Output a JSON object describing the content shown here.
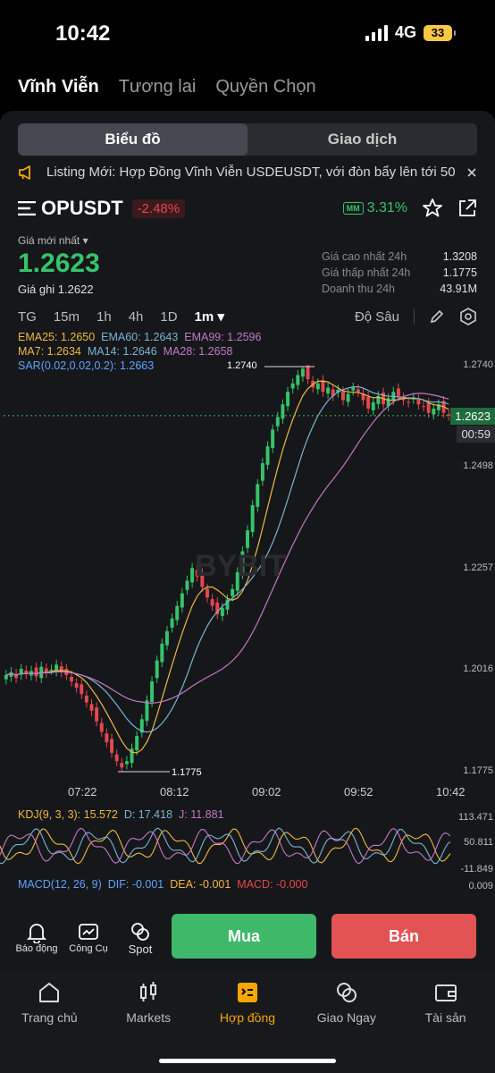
{
  "status": {
    "time": "10:42",
    "network": "4G",
    "battery": "33"
  },
  "top_tabs": [
    {
      "label": "Vĩnh Viễn",
      "active": true
    },
    {
      "label": "Tương lai"
    },
    {
      "label": "Quyền Chọn"
    }
  ],
  "segments": [
    {
      "label": "Biểu đồ",
      "active": true
    },
    {
      "label": "Giao dịch"
    }
  ],
  "announcement": {
    "text": "Listing Mới:  Hợp Đồng Vĩnh Viễn USDEUSDT, với đòn bẩy lên tới 50",
    "icon": "megaphone-icon"
  },
  "ticker": {
    "symbol": "OPUSDT",
    "change": "-2.48%",
    "mm_badge": "MM",
    "mm_ratio": "3.31%"
  },
  "price": {
    "last_label": "Giá mới nhất",
    "last": "1.2623",
    "mark": "Giá ghi 1.2622"
  },
  "stats": [
    {
      "label": "Giá cao nhất 24h",
      "value": "1.3208"
    },
    {
      "label": "Giá thấp nhất 24h",
      "value": "1.1775"
    },
    {
      "label": "Doanh thu 24h",
      "value": "43.91M"
    }
  ],
  "timeframes": {
    "items": [
      "TG",
      "15m",
      "1h",
      "4h",
      "1D",
      "1m ▾"
    ],
    "active_index": 5,
    "depth": "Độ Sâu"
  },
  "indicators": {
    "ema25": "EMA25: 1.2650",
    "ema60": "EMA60: 1.2643",
    "ema99": "EMA99: 1.2596",
    "ma7": "MA7: 1.2634",
    "ma14": "MA14: 1.2646",
    "ma28": "MA28: 1.2658",
    "sar": "SAR(0.02,0.02,0.2): 1.2663"
  },
  "chart_data": {
    "type": "candlestick",
    "y_ticks": [
      "1.2740",
      "1.2498",
      "1.2257",
      "1.2016",
      "1.1775"
    ],
    "x_ticks": [
      "07:22",
      "08:12",
      "09:02",
      "09:52",
      "10:42"
    ],
    "high_marker": "1.2740",
    "low_marker": "1.1775",
    "current_price": "1.2623",
    "countdown": "00:59",
    "watermark": "BYBIT",
    "close_series": [
      1.2005,
      1.2012,
      1.1998,
      1.202,
      1.2008,
      1.2015,
      1.2002,
      1.2025,
      1.201,
      1.2018,
      1.203,
      1.2012,
      1.2005,
      1.199,
      1.1975,
      1.196,
      1.194,
      1.192,
      1.1895,
      1.187,
      1.1845,
      1.182,
      1.18,
      1.1785,
      1.18,
      1.183,
      1.186,
      1.19,
      1.1945,
      1.199,
      1.204,
      1.208,
      1.211,
      1.214,
      1.217,
      1.22,
      1.223,
      1.226,
      1.224,
      1.2215,
      1.219,
      1.217,
      1.215,
      1.2165,
      1.2185,
      1.221,
      1.225,
      1.23,
      1.235,
      1.241,
      1.246,
      1.251,
      1.255,
      1.259,
      1.262,
      1.265,
      1.268,
      1.27,
      1.272,
      1.2735,
      1.271,
      1.269,
      1.27,
      1.268,
      1.269,
      1.267,
      1.2685,
      1.266,
      1.2675,
      1.269,
      1.268,
      1.266,
      1.264,
      1.2655,
      1.267,
      1.265,
      1.2665,
      1.268,
      1.267,
      1.266,
      1.2655,
      1.2665,
      1.265,
      1.2645,
      1.263,
      1.264,
      1.265,
      1.263,
      1.2623
    ],
    "kdj": {
      "label": "KDJ(9, 3, 3): 15.572",
      "d": "D: 17.418",
      "j": "J: 11.881",
      "ticks": [
        "113.471",
        "50.811",
        "-11.849"
      ]
    },
    "macd": {
      "label": "MACD(12, 26, 9)",
      "dif": "DIF: -0.001",
      "dea": "DEA: -0.001",
      "macd": "MACD: -0.000",
      "tick": "0.009"
    }
  },
  "tools": [
    {
      "label": "Báo động",
      "icon": "bell-icon"
    },
    {
      "label": "Công Cụ",
      "icon": "tools-icon"
    },
    {
      "label": "Spot",
      "icon": "spot-icon"
    }
  ],
  "actions": {
    "buy": "Mua",
    "sell": "Bán"
  },
  "nav": [
    {
      "label": "Trang chủ",
      "icon": "home-icon"
    },
    {
      "label": "Markets",
      "icon": "candles-icon"
    },
    {
      "label": "Hợp đồng",
      "icon": "contract-icon",
      "active": true
    },
    {
      "label": "Giao Ngay",
      "icon": "exchange-icon"
    },
    {
      "label": "Tài sản",
      "icon": "wallet-icon"
    }
  ],
  "colors": {
    "up": "#35c46a",
    "down": "#e5484d",
    "accent": "#f7a600",
    "buy": "#3fb86a",
    "sell": "#e25454"
  }
}
